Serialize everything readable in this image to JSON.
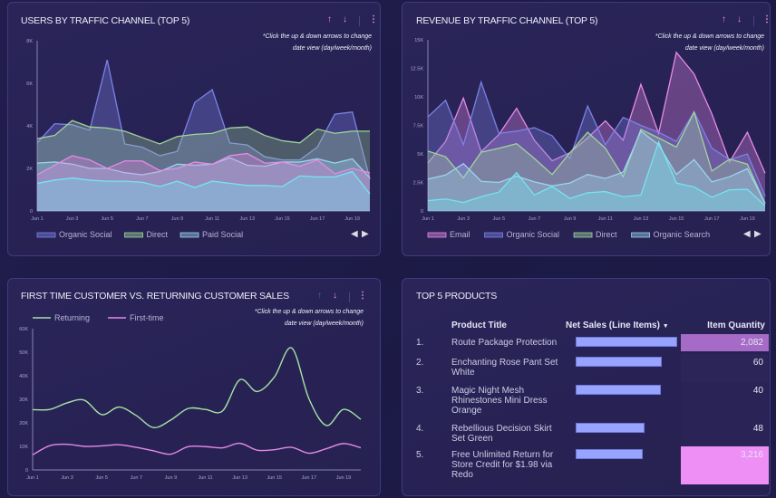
{
  "controls": {
    "up_icon": "arrow-up-icon",
    "down_icon": "arrow-down-icon",
    "menu_icon": "kebab-menu-icon",
    "note": [
      "*Click the up & down arrows to change",
      "date view (day/week/month)"
    ],
    "prev_icon": "triangle-left-icon",
    "next_icon": "triangle-right-icon"
  },
  "cards": [
    {
      "title": "USERS BY TRAFFIC CHANNEL (TOP 5)"
    },
    {
      "title": "REVENUE BY TRAFFIC CHANNEL (TOP 5)"
    },
    {
      "title": "FIRST TIME CUSTOMER VS. RETURNING CUSTOMER SALES"
    },
    {
      "title": "TOP 5 PRODUCTS"
    }
  ],
  "chart_data": [
    {
      "type": "area",
      "x": [
        "Jun 1",
        "Jun 2",
        "Jun 3",
        "Jun 4",
        "Jun 5",
        "Jun 6",
        "Jun 7",
        "Jun 8",
        "Jun 9",
        "Jun 10",
        "Jun 11",
        "Jun 12",
        "Jun 13",
        "Jun 14",
        "Jun 15",
        "Jun 16",
        "Jun 17",
        "Jun 18",
        "Jun 19",
        "Jun 20"
      ],
      "x_tick_labels": [
        "Jun 1",
        "Jun 3",
        "Jun 5",
        "Jun 7",
        "Jun 9",
        "Jun 11",
        "Jun 13",
        "Jun 15",
        "Jun 17",
        "Jun 19"
      ],
      "ylim": [
        0,
        8000
      ],
      "y_tick_labels": [
        "0",
        "2K",
        "4K",
        "6K",
        "8K"
      ],
      "legend": "bottom-left",
      "grid": false,
      "series": [
        {
          "name": "Organic Social",
          "color": "#7b82e6",
          "values": [
            3200,
            4100,
            4050,
            3800,
            7100,
            3150,
            3000,
            2600,
            2800,
            5100,
            5700,
            3200,
            3100,
            2550,
            2400,
            2400,
            3000,
            4550,
            4650,
            1500
          ]
        },
        {
          "name": "Direct",
          "color": "#9fd69b",
          "values": [
            3400,
            3550,
            4250,
            3950,
            3900,
            3750,
            3450,
            3150,
            3500,
            3600,
            3650,
            3900,
            3950,
            3550,
            3300,
            3200,
            3850,
            3650,
            3750,
            3750
          ]
        },
        {
          "name": "Paid Social",
          "color": "#9bd4ee",
          "values": [
            2250,
            2300,
            2200,
            2000,
            2000,
            1800,
            1700,
            1850,
            2200,
            2150,
            2200,
            2500,
            2150,
            2100,
            2300,
            2300,
            2450,
            2250,
            2450,
            1550
          ]
        },
        {
          "color": "#e68ae6",
          "values": [
            1700,
            2150,
            2600,
            2400,
            2000,
            2350,
            2350,
            1900,
            2000,
            2300,
            2200,
            2600,
            2700,
            2250,
            2300,
            2100,
            2400,
            1750,
            2000,
            1800
          ]
        },
        {
          "color": "#74e4f2",
          "values": [
            1300,
            1450,
            1550,
            1450,
            1400,
            1400,
            1350,
            1150,
            1400,
            1100,
            1400,
            1300,
            1200,
            1200,
            1150,
            1650,
            1600,
            1600,
            1850,
            800
          ]
        }
      ]
    },
    {
      "type": "area",
      "x": [
        "Jun 1",
        "Jun 2",
        "Jun 3",
        "Jun 4",
        "Jun 5",
        "Jun 6",
        "Jun 7",
        "Jun 8",
        "Jun 9",
        "Jun 10",
        "Jun 11",
        "Jun 12",
        "Jun 13",
        "Jun 14",
        "Jun 15",
        "Jun 16",
        "Jun 17",
        "Jun 18",
        "Jun 19",
        "Jun 20"
      ],
      "x_tick_labels": [
        "Jun 1",
        "Jun 3",
        "Jun 5",
        "Jun 7",
        "Jun 9",
        "Jun 11",
        "Jun 13",
        "Jun 15",
        "Jun 17",
        "Jun 19"
      ],
      "ylim": [
        0,
        15000
      ],
      "y_tick_labels": [
        "0",
        "2.5K",
        "5K",
        "7.5K",
        "10K",
        "12.5K",
        "15K"
      ],
      "legend": "bottom-left",
      "grid": false,
      "series": [
        {
          "name": "Email",
          "color": "#e68ae6",
          "values": [
            4200,
            6100,
            9900,
            5200,
            6700,
            9000,
            6200,
            4400,
            5100,
            6400,
            7900,
            6200,
            11100,
            6800,
            13900,
            12000,
            8500,
            4300,
            6900,
            3300
          ]
        },
        {
          "name": "Organic Social",
          "color": "#7b82e6",
          "values": [
            8250,
            9700,
            5800,
            11300,
            6800,
            7000,
            7300,
            6600,
            4600,
            9200,
            5800,
            8200,
            7500,
            6900,
            6100,
            8700,
            5500,
            4500,
            5000,
            1300
          ]
        },
        {
          "name": "Direct",
          "color": "#9fd69b",
          "values": [
            5250,
            4750,
            2900,
            5150,
            5500,
            5900,
            4600,
            3200,
            5100,
            6900,
            5500,
            3000,
            7150,
            6400,
            5600,
            8650,
            3500,
            4550,
            4100,
            650
          ]
        },
        {
          "name": "Organic Search",
          "color": "#9bd4ee",
          "values": [
            2800,
            3150,
            4150,
            2600,
            2500,
            3050,
            2550,
            2200,
            2450,
            3200,
            2850,
            3400,
            7000,
            5800,
            3200,
            4500,
            2550,
            3000,
            3700,
            650
          ]
        },
        {
          "color": "#74e4f2",
          "values": [
            900,
            1050,
            750,
            1250,
            1650,
            3350,
            1400,
            2150,
            1100,
            1600,
            1700,
            1250,
            1400,
            6050,
            2450,
            2100,
            1200,
            1850,
            1900,
            450
          ]
        }
      ]
    },
    {
      "type": "line",
      "x": [
        "Jun 1",
        "Jun 2",
        "Jun 3",
        "Jun 4",
        "Jun 5",
        "Jun 6",
        "Jun 7",
        "Jun 8",
        "Jun 9",
        "Jun 10",
        "Jun 11",
        "Jun 12",
        "Jun 13",
        "Jun 14",
        "Jun 15",
        "Jun 16",
        "Jun 17",
        "Jun 18",
        "Jun 19",
        "Jun 20"
      ],
      "x_tick_labels": [
        "Jun 1",
        "Jun 3",
        "Jun 5",
        "Jun 7",
        "Jun 9",
        "Jun 11",
        "Jun 13",
        "Jun 15",
        "Jun 17",
        "Jun 19"
      ],
      "ylim": [
        0,
        60000
      ],
      "y_tick_labels": [
        "0",
        "10K",
        "20K",
        "30K",
        "40K",
        "50K",
        "60K"
      ],
      "legend": "top-left",
      "grid": false,
      "series": [
        {
          "name": "Returning",
          "color": "#a6e3a8",
          "values": [
            25600,
            25700,
            28500,
            29600,
            23500,
            26700,
            23100,
            18000,
            21200,
            26100,
            25700,
            25100,
            38300,
            33300,
            39500,
            51800,
            30200,
            18900,
            25700,
            21500
          ]
        },
        {
          "name": "First-time",
          "color": "#e58ae8",
          "values": [
            6400,
            10300,
            10900,
            10000,
            10200,
            10700,
            9600,
            8100,
            6700,
            9900,
            9900,
            9400,
            11300,
            8400,
            8600,
            9600,
            7100,
            9000,
            11200,
            9400
          ]
        }
      ]
    }
  ],
  "products": {
    "headers": {
      "title": "Product Title",
      "net_sales": "Net Sales (Line Items)",
      "sort_icon": "caret-down-icon",
      "quantity": "Item Quantity"
    },
    "rows": [
      {
        "rank": "1.",
        "title": "Route Package Protection",
        "net_sales_relative": 1.0,
        "quantity": "2,082",
        "heat": "#a56bc6"
      },
      {
        "rank": "2.",
        "title": "Enchanting Rose Pant Set White",
        "net_sales_relative": 0.85,
        "quantity": "60",
        "heat": "#2b2558"
      },
      {
        "rank": "3.",
        "title": "Magic Night Mesh Rhinestones Mini Dress Orange",
        "net_sales_relative": 0.84,
        "quantity": "40",
        "heat": "#2a2456"
      },
      {
        "rank": "4.",
        "title": "Rebellious Decision Skirt Set Green",
        "net_sales_relative": 0.68,
        "quantity": "48",
        "heat": "#2a2456"
      },
      {
        "rank": "5.",
        "title": "Free Unlimited Return for Store Credit for $1.98 via Redo",
        "net_sales_relative": 0.66,
        "quantity": "3,216",
        "heat": "#ee8ff6"
      }
    ]
  }
}
